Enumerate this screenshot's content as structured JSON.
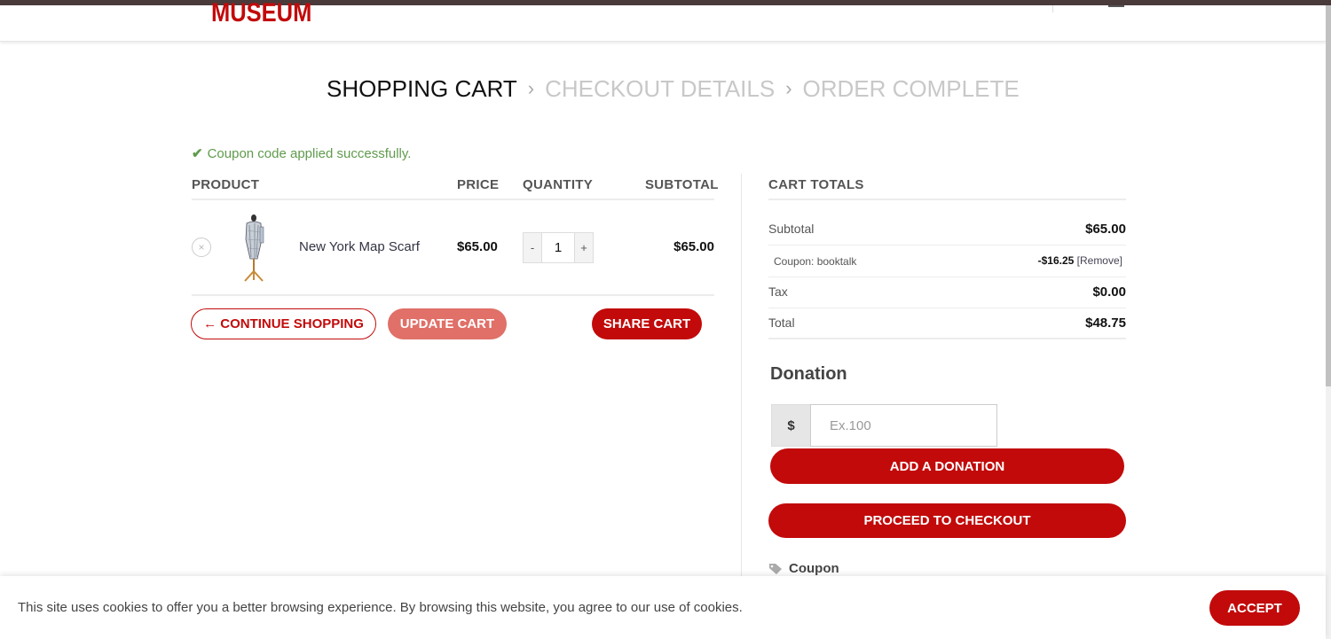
{
  "header": {
    "logo_text": "MUSEUM"
  },
  "steps": {
    "step1": "SHOPPING CART",
    "step2": "CHECKOUT DETAILS",
    "step3": "ORDER COMPLETE",
    "separator": "›"
  },
  "notice": {
    "icon": "checkmark-icon",
    "text": "Coupon code applied successfully."
  },
  "cart_table": {
    "headers": {
      "product": "PRODUCT",
      "price": "PRICE",
      "quantity": "QUANTITY",
      "subtotal": "SUBTOTAL"
    },
    "rows": [
      {
        "remove_icon": "×",
        "product_name": "New York Map Scarf",
        "price": "$65.00",
        "quantity": "1",
        "qty_minus": "-",
        "qty_plus": "+",
        "subtotal": "$65.00"
      }
    ]
  },
  "cart_actions": {
    "continue_label": "← CONTINUE SHOPPING",
    "update_label": "UPDATE CART",
    "share_label": "SHARE CART"
  },
  "cart_totals": {
    "heading": "CART TOTALS",
    "subtotal_label": "Subtotal",
    "subtotal_value": "$65.00",
    "coupon_label": "Coupon: booktalk",
    "coupon_amount": "-$16.25",
    "coupon_remove": "[Remove]",
    "tax_label": "Tax",
    "tax_value": "$0.00",
    "total_label": "Total",
    "total_value": "$48.75"
  },
  "donation": {
    "title": "Donation",
    "currency": "$",
    "placeholder": "Ex.100",
    "button_label": "ADD A DONATION"
  },
  "checkout": {
    "button_label": "PROCEED TO CHECKOUT"
  },
  "coupon_section": {
    "icon": "tag-icon",
    "label": "Coupon"
  },
  "cookie_bar": {
    "text": "This site uses cookies to offer you a better browsing experience. By browsing this website, you agree to our use of cookies.",
    "accept_label": "ACCEPT"
  },
  "colors": {
    "brand_red": "#c20a0a",
    "update_button": "#e07068",
    "success_green": "#5f9b4c"
  }
}
